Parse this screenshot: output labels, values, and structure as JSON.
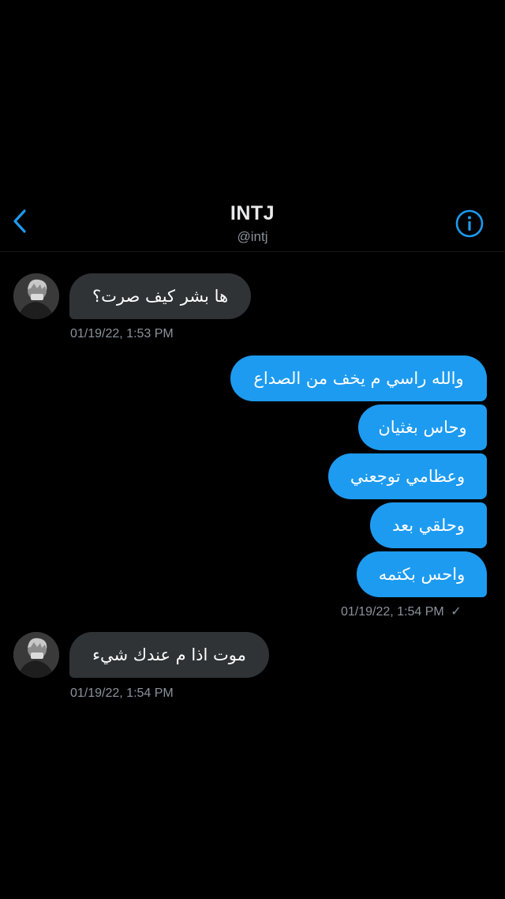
{
  "header": {
    "title": "INTJ",
    "handle": "@intj"
  },
  "colors": {
    "background": "#000000",
    "incoming_bubble": "#2f3336",
    "outgoing_bubble": "#1d9bf0",
    "accent": "#1d9bf0",
    "timestamp": "#8b939b"
  },
  "icons": {
    "back": "chevron-left-icon",
    "info": "info-icon",
    "sent": "checkmark-icon"
  },
  "messages": [
    {
      "direction": "in",
      "text": "ها بشر كيف صرت؟"
    },
    {
      "direction": "out",
      "text": "والله راسي م يخف من الصداع"
    },
    {
      "direction": "out",
      "text": "وحاس بغثيان"
    },
    {
      "direction": "out",
      "text": "وعظامي توجعني"
    },
    {
      "direction": "out",
      "text": "وحلقي بعد"
    },
    {
      "direction": "out",
      "text": "واحس بكتمه"
    },
    {
      "direction": "in",
      "text": "موت اذا م عندك شيء"
    }
  ],
  "timestamps": [
    {
      "text": "01/19/22, 1:53 PM"
    },
    {
      "text": "01/19/22, 1:54 PM",
      "status": "✓"
    },
    {
      "text": "01/19/22, 1:54 PM"
    }
  ]
}
